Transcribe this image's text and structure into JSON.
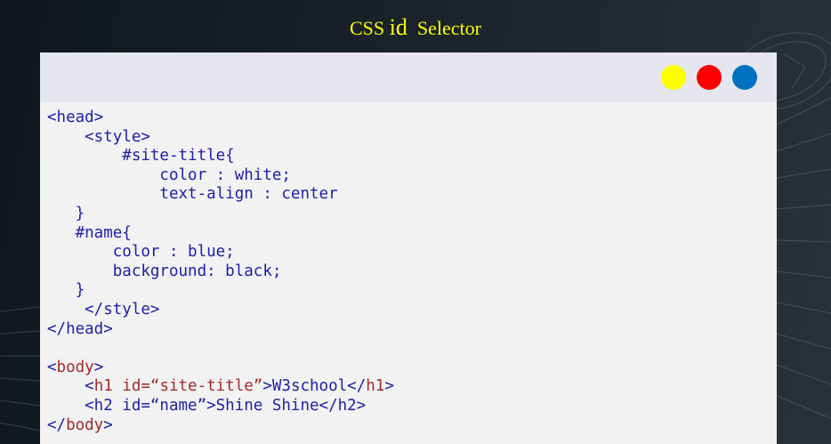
{
  "slide": {
    "title_prefix": "CSS",
    "title_main": "id",
    "title_suffix": "Selector"
  },
  "window": {
    "buttons": [
      {
        "name": "yellow",
        "color": "#ffff00"
      },
      {
        "name": "red",
        "color": "#ff0000"
      },
      {
        "name": "blue",
        "color": "#0070c0"
      }
    ]
  },
  "code": {
    "lines": [
      [
        {
          "t": "<head>",
          "c": "tag"
        }
      ],
      [
        {
          "t": "    <style>",
          "c": "tag"
        }
      ],
      [
        {
          "t": "        #site-title{",
          "c": "tag"
        }
      ],
      [
        {
          "t": "            color : white;",
          "c": "tag"
        }
      ],
      [
        {
          "t": "            text-align : center",
          "c": "tag"
        }
      ],
      [
        {
          "t": "   }",
          "c": "tag"
        }
      ],
      [
        {
          "t": "   #name{",
          "c": "tag"
        }
      ],
      [
        {
          "t": "       color : blue;",
          "c": "tag"
        }
      ],
      [
        {
          "t": "       background: black;",
          "c": "tag"
        }
      ],
      [
        {
          "t": "   }",
          "c": "tag"
        }
      ],
      [
        {
          "t": "    </style>",
          "c": "tag"
        }
      ],
      [
        {
          "t": "</head>",
          "c": "tag"
        }
      ],
      [
        {
          "t": "",
          "c": "tag"
        }
      ],
      [
        {
          "t": "<",
          "c": "tag"
        },
        {
          "t": "body",
          "c": "red-tok"
        },
        {
          "t": ">",
          "c": "tag"
        }
      ],
      [
        {
          "t": "    <",
          "c": "tag"
        },
        {
          "t": "h1 id=“site-title”",
          "c": "red-tok"
        },
        {
          "t": ">W3school</",
          "c": "tag"
        },
        {
          "t": "h1",
          "c": "red-tok"
        },
        {
          "t": ">",
          "c": "tag"
        }
      ],
      [
        {
          "t": "    <h2 id=“name”>Shine Shine</h2>",
          "c": "tag"
        }
      ],
      [
        {
          "t": "</",
          "c": "tag"
        },
        {
          "t": "body",
          "c": "red-tok"
        },
        {
          "t": ">",
          "c": "tag"
        }
      ]
    ]
  }
}
